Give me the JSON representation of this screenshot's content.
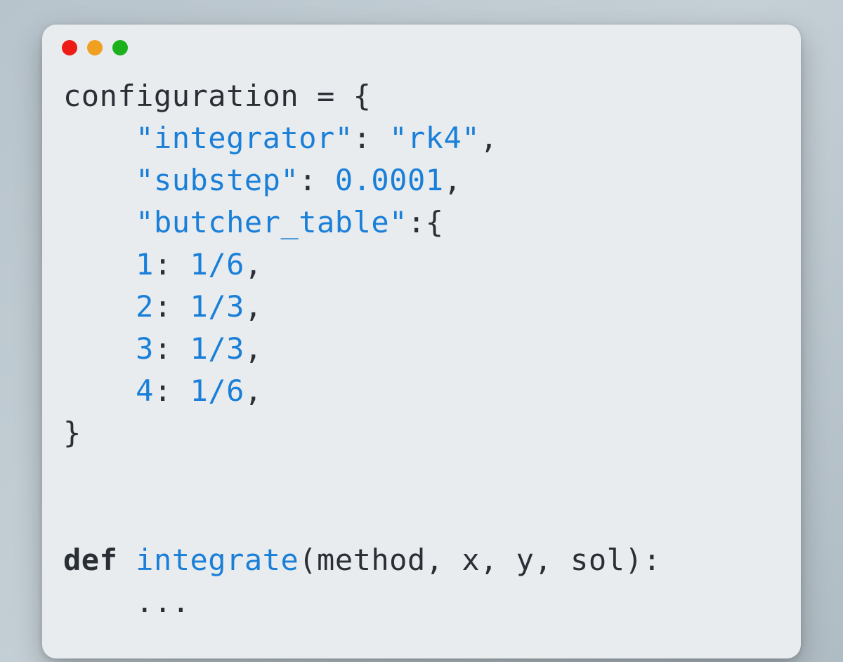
{
  "code": {
    "var_name": "configuration",
    "assign": " = {",
    "key_integrator": "\"integrator\"",
    "val_integrator": "\"rk4\"",
    "key_substep": "\"substep\"",
    "val_substep": "0.0001",
    "key_butcher": "\"butcher_table\"",
    "brace_open": "{",
    "bt_k1": "1",
    "bt_v1": "1/6",
    "bt_k2": "2",
    "bt_v2": "1/3",
    "bt_k3": "3",
    "bt_v3": "1/3",
    "bt_k4": "4",
    "bt_v4": "1/6",
    "close_brace": "}",
    "def_kw": "def",
    "func_name": "integrate",
    "paren_open": "(",
    "params": "method, x, y, sol",
    "paren_close_colon": "):",
    "ellipsis": "...",
    "colon": ":",
    "comma": ","
  },
  "traffic_lights": {
    "close": "close",
    "minimize": "minimize",
    "zoom": "zoom"
  }
}
